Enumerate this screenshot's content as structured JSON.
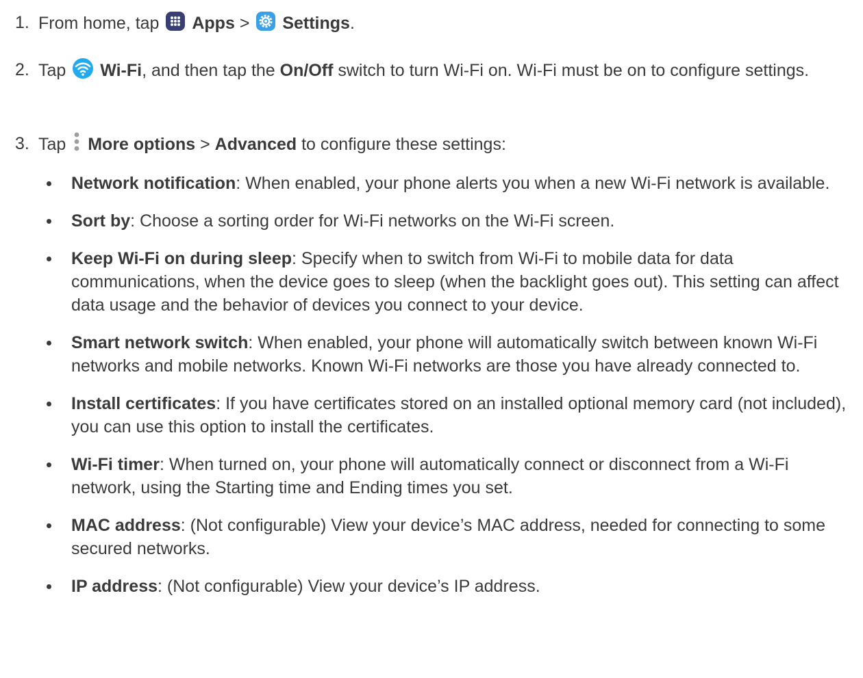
{
  "steps": [
    {
      "number": "1.",
      "t1": "From home, tap",
      "apps_icon": "apps-grid-icon",
      "b1": "Apps",
      "t2": ">",
      "settings_icon": "settings-gear-icon",
      "b2": "Settings",
      "t3": "."
    },
    {
      "number": "2.",
      "t1": "Tap",
      "wifi_icon": "wifi-icon",
      "b1": "Wi-Fi",
      "t2": ", and then tap the",
      "b2": "On/Off",
      "t3": "switch to turn Wi-Fi on. Wi-Fi must be on to configure settings."
    },
    {
      "number": "3.",
      "t1": "Tap",
      "more_icon": "more-options-icon",
      "b1": "More options",
      "t2": ">",
      "b2": "Advanced",
      "t3": "to configure these settings:"
    }
  ],
  "settings": [
    {
      "term": "Network notification",
      "desc": ": When enabled, your phone alerts you when a new Wi-Fi network is available."
    },
    {
      "term": "Sort by",
      "desc": ": Choose a sorting order for Wi-Fi networks on the Wi-Fi screen."
    },
    {
      "term": "Keep Wi-Fi on during sleep",
      "desc": ": Specify when to switch from Wi-Fi to mobile data for data communications, when the device goes to sleep (when the backlight goes out). This setting can affect data usage and the behavior of devices you connect to your device."
    },
    {
      "term": "Smart network switch",
      "desc": ": When enabled, your phone will automatically switch between known Wi-Fi networks and mobile networks. Known Wi-Fi networks are those you have already connected to."
    },
    {
      "term": "Install certificates",
      "desc": ": If you have certificates stored on an installed optional memory card (not included), you can use this option to install the certificates."
    },
    {
      "term": "Wi-Fi timer",
      "desc": ": When turned on, your phone will automatically connect or disconnect from a Wi-Fi network, using the Starting time and Ending times you set."
    },
    {
      "term": "MAC address",
      "desc": ": (Not configurable) View your device’s MAC address, needed for connecting to some secured networks."
    },
    {
      "term": "IP address",
      "desc": ": (Not configurable) View your device’s IP address."
    }
  ],
  "colors": {
    "text": "#3a3a3a",
    "apps_icon": "#3a3f73",
    "settings_icon": "#3aa0e8",
    "wifi_icon": "#22aaee"
  }
}
